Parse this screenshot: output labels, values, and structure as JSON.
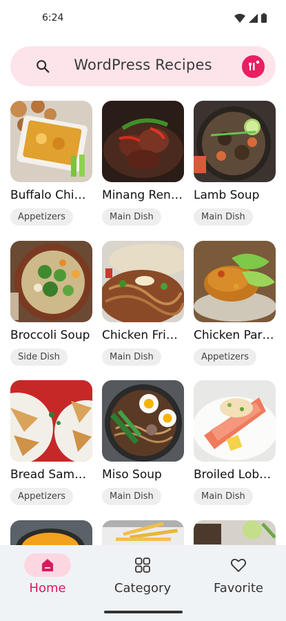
{
  "status": {
    "time": "6:24"
  },
  "search": {
    "title": "WordPress Recipes"
  },
  "recipes": [
    {
      "title": "Buffalo Chic…",
      "category": "Appetizers"
    },
    {
      "title": "Minang Ren…",
      "category": "Main Dish"
    },
    {
      "title": "Lamb Soup",
      "category": "Main Dish"
    },
    {
      "title": "Broccoli Soup",
      "category": "Side Dish"
    },
    {
      "title": "Chicken Frie…",
      "category": "Main Dish"
    },
    {
      "title": "Chicken Par…",
      "category": "Appetizers"
    },
    {
      "title": "Bread Samo…",
      "category": "Appetizers"
    },
    {
      "title": "Miso Soup",
      "category": "Main Dish"
    },
    {
      "title": "Broiled Lobst…",
      "category": "Main Dish"
    }
  ],
  "nav": {
    "items": [
      {
        "label": "Home",
        "active": true
      },
      {
        "label": "Category",
        "active": false
      },
      {
        "label": "Favorite",
        "active": false
      }
    ]
  },
  "colors": {
    "accent": "#e91e63",
    "search_bg": "#fde4ea",
    "nav_bg": "#f0f3f6"
  }
}
